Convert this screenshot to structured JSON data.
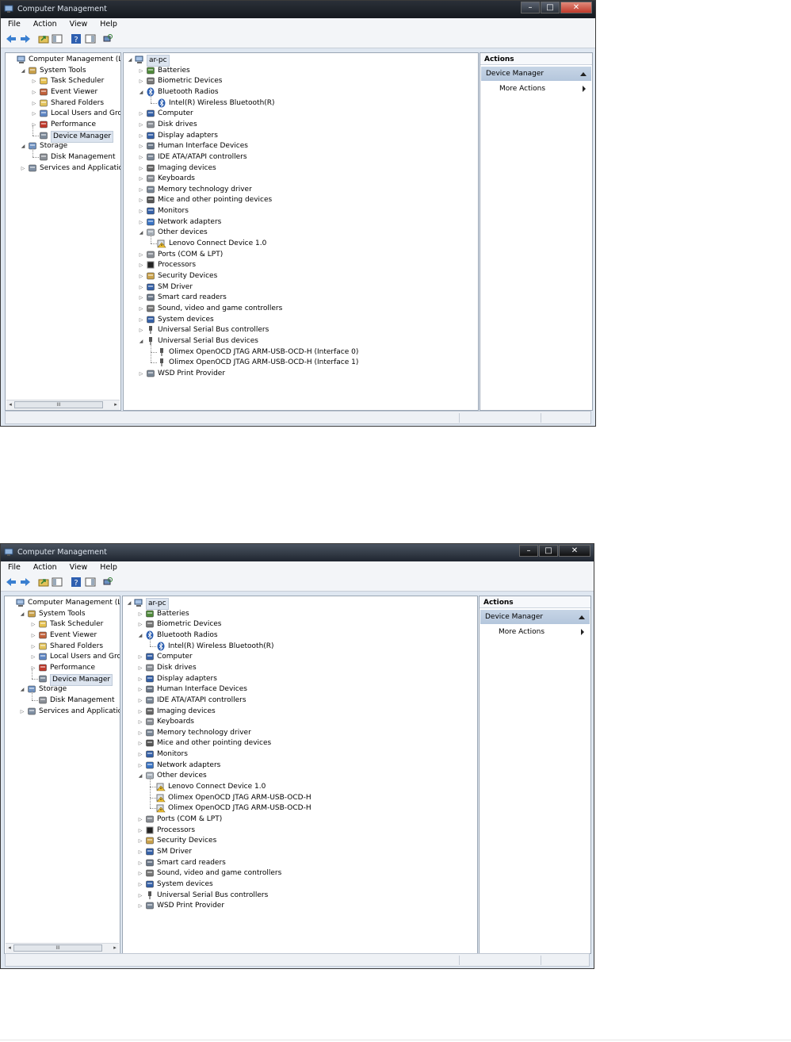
{
  "window_title": "Computer Management",
  "menu": [
    "File",
    "Action",
    "View",
    "Help"
  ],
  "caption_buttons": {
    "minimize": "–",
    "maximize": "□",
    "close": "✕"
  },
  "left_tree": [
    {
      "label": "Computer Management (Local",
      "depth": 0,
      "icon": "computer-management-icon",
      "expander": ""
    },
    {
      "label": "System Tools",
      "depth": 1,
      "icon": "system-tools-icon",
      "expander": "◢"
    },
    {
      "label": "Task Scheduler",
      "depth": 2,
      "icon": "clock-icon",
      "expander": "▷"
    },
    {
      "label": "Event Viewer",
      "depth": 2,
      "icon": "event-viewer-icon",
      "expander": "▷"
    },
    {
      "label": "Shared Folders",
      "depth": 2,
      "icon": "shared-folder-icon",
      "expander": "▷"
    },
    {
      "label": "Local Users and Groups",
      "depth": 2,
      "icon": "users-icon",
      "expander": "▷"
    },
    {
      "label": "Performance",
      "depth": 2,
      "icon": "performance-icon",
      "expander": "▷"
    },
    {
      "label": "Device Manager",
      "depth": 2,
      "icon": "device-manager-icon",
      "expander": "",
      "selected": true
    },
    {
      "label": "Storage",
      "depth": 1,
      "icon": "storage-icon",
      "expander": "◢"
    },
    {
      "label": "Disk Management",
      "depth": 2,
      "icon": "disk-icon",
      "expander": ""
    },
    {
      "label": "Services and Applications",
      "depth": 1,
      "icon": "services-icon",
      "expander": "▷"
    }
  ],
  "device_tree_1": [
    {
      "label": "ar-pc",
      "depth": 0,
      "icon": "computer-icon",
      "expander": "◢",
      "root": true
    },
    {
      "label": "Batteries",
      "depth": 1,
      "icon": "battery-icon",
      "expander": "▷"
    },
    {
      "label": "Biometric Devices",
      "depth": 1,
      "icon": "biometric-icon",
      "expander": "▷"
    },
    {
      "label": "Bluetooth Radios",
      "depth": 1,
      "icon": "bluetooth-icon",
      "expander": "◢"
    },
    {
      "label": "Intel(R) Wireless Bluetooth(R)",
      "depth": 2,
      "icon": "bluetooth-icon",
      "expander": ""
    },
    {
      "label": "Computer",
      "depth": 1,
      "icon": "monitor-icon",
      "expander": "▷"
    },
    {
      "label": "Disk drives",
      "depth": 1,
      "icon": "disk-icon",
      "expander": "▷"
    },
    {
      "label": "Display adapters",
      "depth": 1,
      "icon": "display-adapter-icon",
      "expander": "▷"
    },
    {
      "label": "Human Interface Devices",
      "depth": 1,
      "icon": "hid-icon",
      "expander": "▷"
    },
    {
      "label": "IDE ATA/ATAPI controllers",
      "depth": 1,
      "icon": "ide-icon",
      "expander": "▷"
    },
    {
      "label": "Imaging devices",
      "depth": 1,
      "icon": "camera-icon",
      "expander": "▷"
    },
    {
      "label": "Keyboards",
      "depth": 1,
      "icon": "keyboard-icon",
      "expander": "▷"
    },
    {
      "label": "Memory technology driver",
      "depth": 1,
      "icon": "memory-icon",
      "expander": "▷"
    },
    {
      "label": "Mice and other pointing devices",
      "depth": 1,
      "icon": "mouse-icon",
      "expander": "▷"
    },
    {
      "label": "Monitors",
      "depth": 1,
      "icon": "monitor-icon",
      "expander": "▷"
    },
    {
      "label": "Network adapters",
      "depth": 1,
      "icon": "network-icon",
      "expander": "▷"
    },
    {
      "label": "Other devices",
      "depth": 1,
      "icon": "other-devices-icon",
      "expander": "◢"
    },
    {
      "label": "Lenovo Connect Device 1.0",
      "depth": 2,
      "icon": "warning-device-icon",
      "expander": ""
    },
    {
      "label": "Ports (COM & LPT)",
      "depth": 1,
      "icon": "port-icon",
      "expander": "▷"
    },
    {
      "label": "Processors",
      "depth": 1,
      "icon": "processor-icon",
      "expander": "▷"
    },
    {
      "label": "Security Devices",
      "depth": 1,
      "icon": "security-icon",
      "expander": "▷"
    },
    {
      "label": "SM Driver",
      "depth": 1,
      "icon": "monitor-icon",
      "expander": "▷"
    },
    {
      "label": "Smart card readers",
      "depth": 1,
      "icon": "smartcard-icon",
      "expander": "▷"
    },
    {
      "label": "Sound, video and game controllers",
      "depth": 1,
      "icon": "speaker-icon",
      "expander": "▷"
    },
    {
      "label": "System devices",
      "depth": 1,
      "icon": "monitor-icon",
      "expander": "▷"
    },
    {
      "label": "Universal Serial Bus controllers",
      "depth": 1,
      "icon": "usb-icon",
      "expander": "▷"
    },
    {
      "label": "Universal Serial Bus devices",
      "depth": 1,
      "icon": "usb-icon",
      "expander": "◢"
    },
    {
      "label": "Olimex OpenOCD JTAG ARM-USB-OCD-H (Interface 0)",
      "depth": 2,
      "icon": "usb-icon",
      "expander": ""
    },
    {
      "label": "Olimex OpenOCD JTAG ARM-USB-OCD-H (Interface 1)",
      "depth": 2,
      "icon": "usb-icon",
      "expander": ""
    },
    {
      "label": "WSD Print Provider",
      "depth": 1,
      "icon": "printer-icon",
      "expander": "▷"
    }
  ],
  "device_tree_2": [
    {
      "label": "ar-pc",
      "depth": 0,
      "icon": "computer-icon",
      "expander": "◢",
      "root": true
    },
    {
      "label": "Batteries",
      "depth": 1,
      "icon": "battery-icon",
      "expander": "▷"
    },
    {
      "label": "Biometric Devices",
      "depth": 1,
      "icon": "biometric-icon",
      "expander": "▷"
    },
    {
      "label": "Bluetooth Radios",
      "depth": 1,
      "icon": "bluetooth-icon",
      "expander": "◢"
    },
    {
      "label": "Intel(R) Wireless Bluetooth(R)",
      "depth": 2,
      "icon": "bluetooth-icon",
      "expander": ""
    },
    {
      "label": "Computer",
      "depth": 1,
      "icon": "monitor-icon",
      "expander": "▷"
    },
    {
      "label": "Disk drives",
      "depth": 1,
      "icon": "disk-icon",
      "expander": "▷"
    },
    {
      "label": "Display adapters",
      "depth": 1,
      "icon": "display-adapter-icon",
      "expander": "▷"
    },
    {
      "label": "Human Interface Devices",
      "depth": 1,
      "icon": "hid-icon",
      "expander": "▷"
    },
    {
      "label": "IDE ATA/ATAPI controllers",
      "depth": 1,
      "icon": "ide-icon",
      "expander": "▷"
    },
    {
      "label": "Imaging devices",
      "depth": 1,
      "icon": "camera-icon",
      "expander": "▷"
    },
    {
      "label": "Keyboards",
      "depth": 1,
      "icon": "keyboard-icon",
      "expander": "▷"
    },
    {
      "label": "Memory technology driver",
      "depth": 1,
      "icon": "memory-icon",
      "expander": "▷"
    },
    {
      "label": "Mice and other pointing devices",
      "depth": 1,
      "icon": "mouse-icon",
      "expander": "▷"
    },
    {
      "label": "Monitors",
      "depth": 1,
      "icon": "monitor-icon",
      "expander": "▷"
    },
    {
      "label": "Network adapters",
      "depth": 1,
      "icon": "network-icon",
      "expander": "▷"
    },
    {
      "label": "Other devices",
      "depth": 1,
      "icon": "other-devices-icon",
      "expander": "◢"
    },
    {
      "label": "Lenovo Connect Device 1.0",
      "depth": 2,
      "icon": "warning-device-icon",
      "expander": ""
    },
    {
      "label": "Olimex OpenOCD JTAG ARM-USB-OCD-H",
      "depth": 2,
      "icon": "warning-device-icon",
      "expander": ""
    },
    {
      "label": "Olimex OpenOCD JTAG ARM-USB-OCD-H",
      "depth": 2,
      "icon": "warning-device-icon",
      "expander": ""
    },
    {
      "label": "Ports (COM & LPT)",
      "depth": 1,
      "icon": "port-icon",
      "expander": "▷"
    },
    {
      "label": "Processors",
      "depth": 1,
      "icon": "processor-icon",
      "expander": "▷"
    },
    {
      "label": "Security Devices",
      "depth": 1,
      "icon": "security-icon",
      "expander": "▷"
    },
    {
      "label": "SM Driver",
      "depth": 1,
      "icon": "monitor-icon",
      "expander": "▷"
    },
    {
      "label": "Smart card readers",
      "depth": 1,
      "icon": "smartcard-icon",
      "expander": "▷"
    },
    {
      "label": "Sound, video and game controllers",
      "depth": 1,
      "icon": "speaker-icon",
      "expander": "▷"
    },
    {
      "label": "System devices",
      "depth": 1,
      "icon": "monitor-icon",
      "expander": "▷"
    },
    {
      "label": "Universal Serial Bus controllers",
      "depth": 1,
      "icon": "usb-icon",
      "expander": "▷"
    },
    {
      "label": "WSD Print Provider",
      "depth": 1,
      "icon": "printer-icon",
      "expander": "▷"
    }
  ],
  "actions": {
    "header": "Actions",
    "section": "Device Manager",
    "more": "More Actions"
  },
  "scroll_thumb_label": "III",
  "colors": {
    "selected_bg": "#dce4ef",
    "actions_header_bg": "#b4c6dc",
    "titlebar": "#1f2630"
  }
}
